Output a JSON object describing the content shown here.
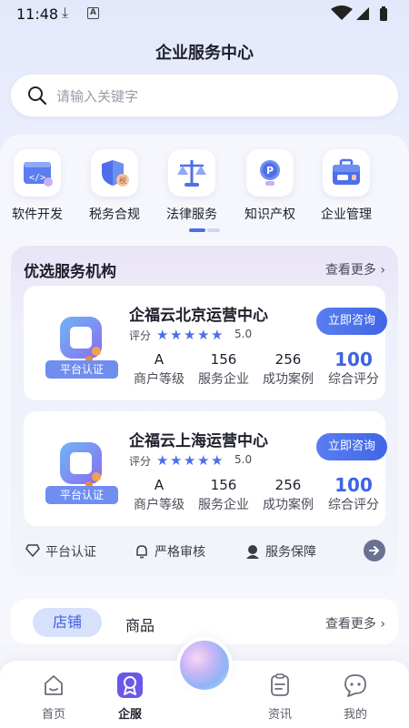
{
  "status": {
    "time": "11:48"
  },
  "header": {
    "title": "企业服务中心"
  },
  "search": {
    "placeholder": "请输入关键字"
  },
  "categories": [
    {
      "label": "软件开发",
      "icon": "code-window-icon"
    },
    {
      "label": "税务合规",
      "icon": "shield-tax-icon"
    },
    {
      "label": "法律服务",
      "icon": "scales-icon"
    },
    {
      "label": "知识产权",
      "icon": "lightbulb-patent-icon"
    },
    {
      "label": "企业管理",
      "icon": "briefcase-icon"
    }
  ],
  "institutions": {
    "title": "优选服务机构",
    "more": "查看更多",
    "rating_label": "评分",
    "consult_label": "立即咨询",
    "badge_text": "平台认证",
    "stat_labels": [
      "商户等级",
      "服务企业",
      "成功案例",
      "综合评分"
    ],
    "items": [
      {
        "name": "企福云北京运营中心",
        "rating": "5.0",
        "stars": 5,
        "level": "A",
        "served": "156",
        "cases": "256",
        "score": "100"
      },
      {
        "name": "企福云上海运营中心",
        "rating": "5.0",
        "stars": 5,
        "level": "A",
        "served": "156",
        "cases": "256",
        "score": "100"
      }
    ],
    "guarantees": [
      "平台认证",
      "严格审核",
      "服务保障"
    ]
  },
  "shop": {
    "tabs": [
      "店铺",
      "商品"
    ],
    "active_tab": "店铺",
    "more": "查看更多"
  },
  "nav": {
    "items": [
      {
        "label": "首页",
        "icon": "home-icon"
      },
      {
        "label": "企服",
        "icon": "enterprise-badge-icon",
        "active": true
      },
      {
        "label": "资讯",
        "icon": "news-clipboard-icon"
      },
      {
        "label": "我的",
        "icon": "profile-chat-icon"
      }
    ]
  },
  "colors": {
    "accent": "#3e63e3",
    "accent_light": "#d8e1fb",
    "star": "#4b6fe8"
  }
}
